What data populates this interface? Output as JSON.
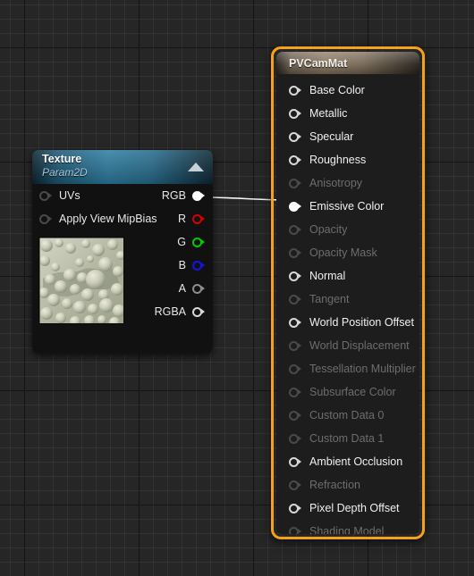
{
  "canvas": {
    "background_color": "#262626",
    "grid_minor_color": "#2f2f2f",
    "grid_major_color": "#000000"
  },
  "wire": {
    "color": "#ffffff",
    "from_pin": "RGB",
    "to_pin": "Emissive Color"
  },
  "texture_node": {
    "title": "Texture",
    "subtitle": "Param2D",
    "header_color": "#2e7fa3",
    "collapse_icon": "triangle-up-icon",
    "inputs": [
      {
        "label": "UVs",
        "pin": "ring",
        "state": "dim"
      },
      {
        "label": "Apply View MipBias",
        "pin": "ring",
        "state": "dim"
      }
    ],
    "outputs": [
      {
        "label": "RGB",
        "pin": "filled",
        "state": "connected",
        "color": "#ffffff"
      },
      {
        "label": "R",
        "pin": "ring",
        "state": "idle",
        "color": "#d40000"
      },
      {
        "label": "G",
        "pin": "ring",
        "state": "idle",
        "color": "#00cc00"
      },
      {
        "label": "B",
        "pin": "ring",
        "state": "idle",
        "color": "#1414e6"
      },
      {
        "label": "A",
        "pin": "ring",
        "state": "idle",
        "color": "#8d8d8d"
      },
      {
        "label": "RGBA",
        "pin": "ring",
        "state": "idle",
        "color": "#ffffff"
      }
    ],
    "thumbnail": {
      "name": "texture-preview-thumbnail",
      "description": "bubbly grey-green sphere cluster texture"
    }
  },
  "material_node": {
    "title": "PVCamMat",
    "selected": true,
    "selection_color": "#f5a11a",
    "header_color": "#8b7a64",
    "inputs": [
      {
        "label": "Base Color",
        "enabled": true,
        "connected": false
      },
      {
        "label": "Metallic",
        "enabled": true,
        "connected": false
      },
      {
        "label": "Specular",
        "enabled": true,
        "connected": false
      },
      {
        "label": "Roughness",
        "enabled": true,
        "connected": false
      },
      {
        "label": "Anisotropy",
        "enabled": false,
        "connected": false
      },
      {
        "label": "Emissive Color",
        "enabled": true,
        "connected": true
      },
      {
        "label": "Opacity",
        "enabled": false,
        "connected": false
      },
      {
        "label": "Opacity Mask",
        "enabled": false,
        "connected": false
      },
      {
        "label": "Normal",
        "enabled": true,
        "connected": false
      },
      {
        "label": "Tangent",
        "enabled": false,
        "connected": false
      },
      {
        "label": "World Position Offset",
        "enabled": true,
        "connected": false
      },
      {
        "label": "World Displacement",
        "enabled": false,
        "connected": false
      },
      {
        "label": "Tessellation Multiplier",
        "enabled": false,
        "connected": false
      },
      {
        "label": "Subsurface Color",
        "enabled": false,
        "connected": false
      },
      {
        "label": "Custom Data 0",
        "enabled": false,
        "connected": false
      },
      {
        "label": "Custom Data 1",
        "enabled": false,
        "connected": false
      },
      {
        "label": "Ambient Occlusion",
        "enabled": true,
        "connected": false
      },
      {
        "label": "Refraction",
        "enabled": false,
        "connected": false
      },
      {
        "label": "Pixel Depth Offset",
        "enabled": true,
        "connected": false
      },
      {
        "label": "Shading Model",
        "enabled": false,
        "connected": false
      }
    ]
  }
}
